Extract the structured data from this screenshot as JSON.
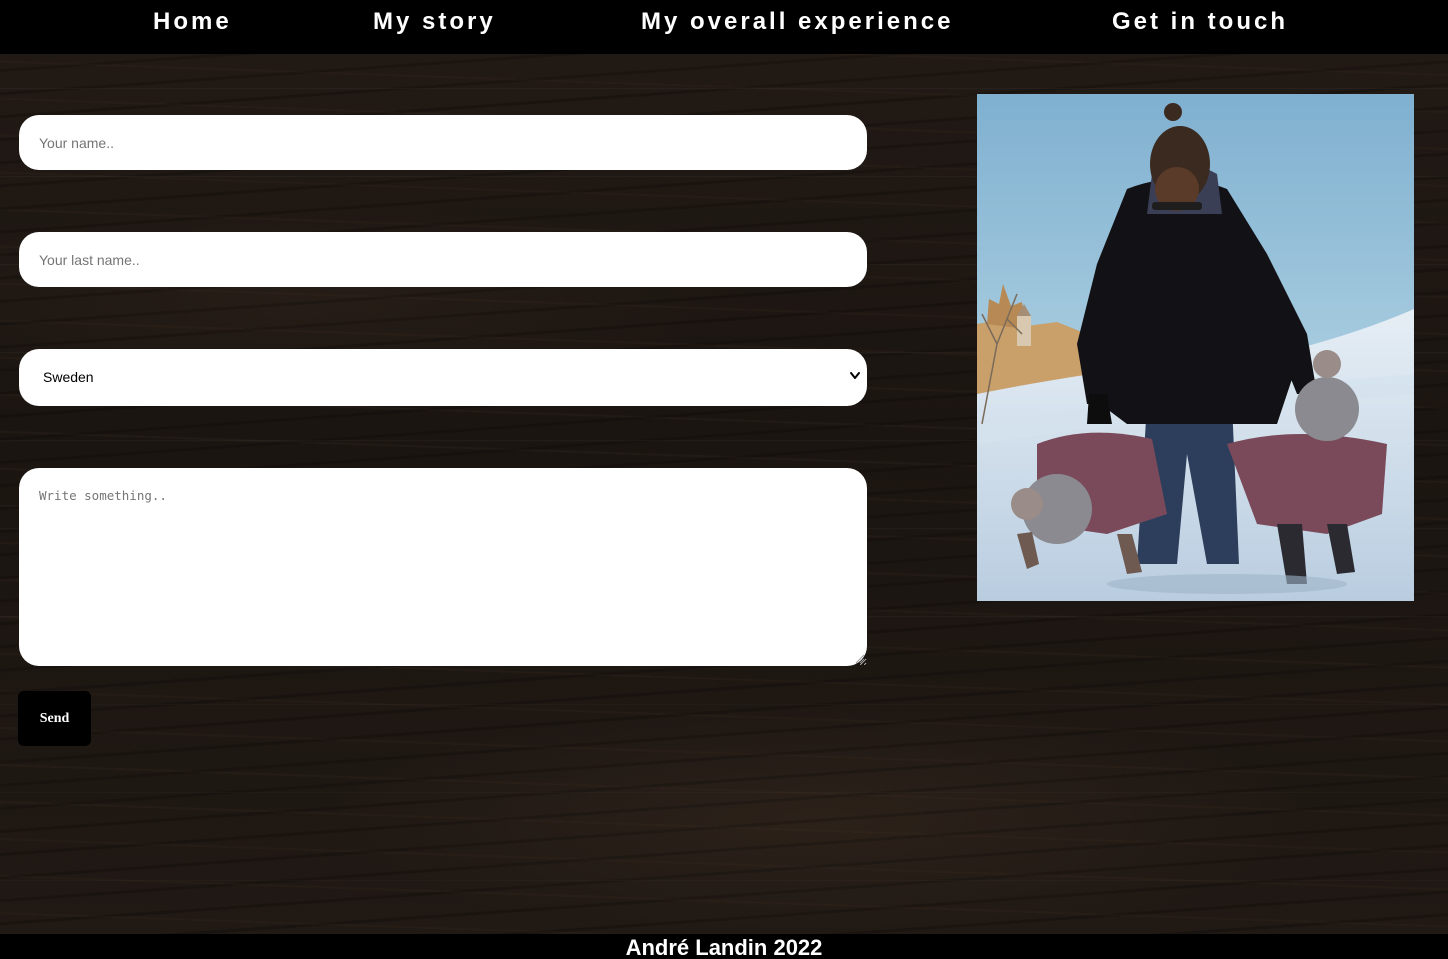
{
  "nav": {
    "items": [
      {
        "label": "Home"
      },
      {
        "label": "My story"
      },
      {
        "label": "My overall experience"
      },
      {
        "label": "Get in touch"
      }
    ]
  },
  "form": {
    "first_name_placeholder": "Your name..",
    "last_name_placeholder": "Your last name..",
    "country_selected": "Sweden",
    "message_placeholder": "Write something..",
    "send_label": "Send"
  },
  "footer": {
    "text": "André Landin 2022"
  },
  "colors": {
    "nav_bg": "#000000",
    "page_bg": "#1c1612",
    "field_bg": "#ffffff",
    "button_bg": "#000000"
  },
  "icons": [
    "chevron-down-icon",
    "resize-grip-icon"
  ]
}
